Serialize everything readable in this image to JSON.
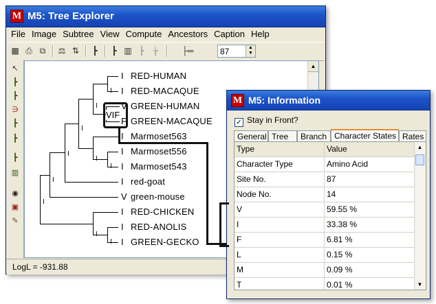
{
  "tree_window": {
    "title": "M5: Tree Explorer",
    "app_icon": "M",
    "menu": [
      "File",
      "Image",
      "Subtree",
      "View",
      "Compute",
      "Ancestors",
      "Caption",
      "Help"
    ],
    "toolbar_icons": [
      "save-icon",
      "print-icon",
      "copy-icon",
      "root-icon",
      "flip-icon",
      "tree-style-icon",
      "taxon-icon",
      "branch-icon",
      "caption-icon",
      "search-icon",
      "settings-icon"
    ],
    "spin_value": "87",
    "left_tools": [
      "pointer-icon",
      "root-branch-icon",
      "flip-subtree-icon",
      "compress-icon",
      "swap-icon",
      "subtree-icon",
      "taxon-name-icon",
      "branch-info-icon",
      "find-icon",
      "zoom-icon",
      "edit-icon"
    ],
    "status": "LogL = -931.88",
    "leaves": [
      {
        "state": "I",
        "name": "RED-HUMAN"
      },
      {
        "state": "I",
        "name": "RED-MACAQUE"
      },
      {
        "state": "V",
        "name": "GREEN-HUMAN"
      },
      {
        "state": "F",
        "name": "GREEN-MACAQUE"
      },
      {
        "state": "I",
        "name": "Marmoset563"
      },
      {
        "state": "I",
        "name": "Marmoset556"
      },
      {
        "state": "I",
        "name": "Marmoset543"
      },
      {
        "state": "I",
        "name": "red-goat"
      },
      {
        "state": "V",
        "name": "green-mouse"
      },
      {
        "state": "I",
        "name": "RED-CHICKEN"
      },
      {
        "state": "I",
        "name": "RED-ANOLIS"
      },
      {
        "state": "I",
        "name": "GREEN-GECKO"
      }
    ],
    "node_labels": [
      "I",
      "I",
      "I",
      "I",
      "I",
      "I",
      "I",
      "I",
      "I",
      "I"
    ],
    "highlight_label": "VIF"
  },
  "info_window": {
    "title": "M5: Information",
    "app_icon": "M",
    "stay_in_front": "Stay in Front?",
    "stay_checked": true,
    "tabs": [
      "General",
      "Tree",
      "Branch",
      "Character States",
      "Rates"
    ],
    "active_tab": "Character States",
    "columns": [
      "Type",
      "Value"
    ],
    "rows": [
      {
        "type": "Character Type",
        "value": "Amino Acid"
      },
      {
        "type": "Site No.",
        "value": "87"
      },
      {
        "type": "Node No.",
        "value": "14"
      },
      {
        "type": "V",
        "value": "59.55 %"
      },
      {
        "type": "I",
        "value": "33.38 %"
      },
      {
        "type": "F",
        "value": "6.81 %"
      },
      {
        "type": "L",
        "value": "0.15 %"
      },
      {
        "type": "M",
        "value": "0.09 %"
      },
      {
        "type": "T",
        "value": "0.01 %"
      }
    ]
  }
}
